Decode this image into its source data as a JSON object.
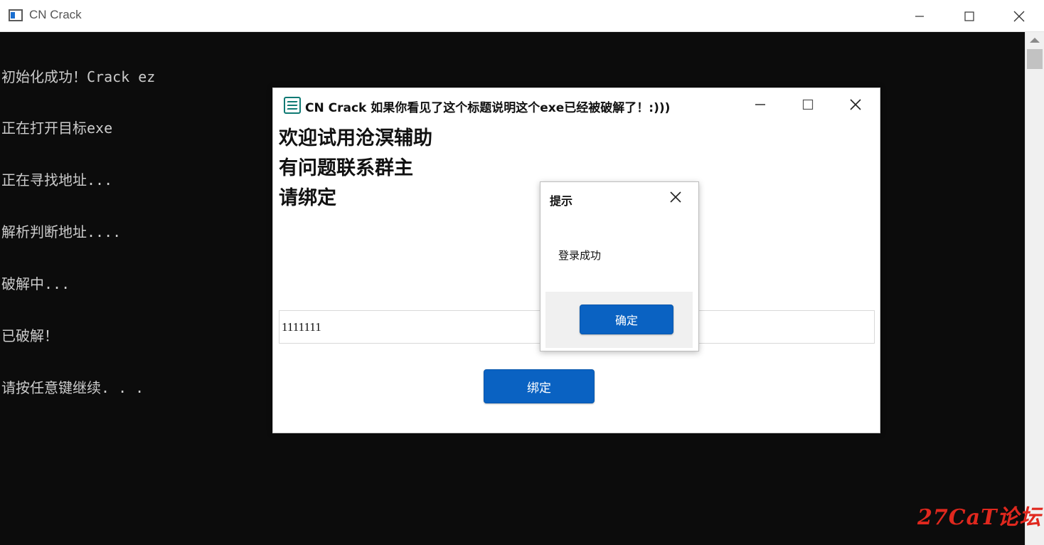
{
  "console": {
    "title": "CN Crack",
    "lines": [
      "初始化成功！Crack ez",
      "正在打开目标exe",
      "正在寻找地址...",
      "解析判断地址....",
      "破解中...",
      "已破解！",
      "请按任意键继续. . ."
    ]
  },
  "app": {
    "title": "CN Crack 如果你看见了这个标题说明这个exe已经被破解了！:)))",
    "welcome_lines": [
      "欢迎试用沧溟辅助",
      "有问题联系群主",
      "请绑定"
    ],
    "key_value": "1111111",
    "bind_label": "绑定"
  },
  "dialog": {
    "title": "提示",
    "message": "登录成功",
    "ok_label": "确定"
  },
  "watermark": "27CaT论坛",
  "colors": {
    "accent": "#0a62c2",
    "console_bg": "#0c0c0c",
    "console_text": "#cccccc",
    "watermark": "#e0281e"
  }
}
